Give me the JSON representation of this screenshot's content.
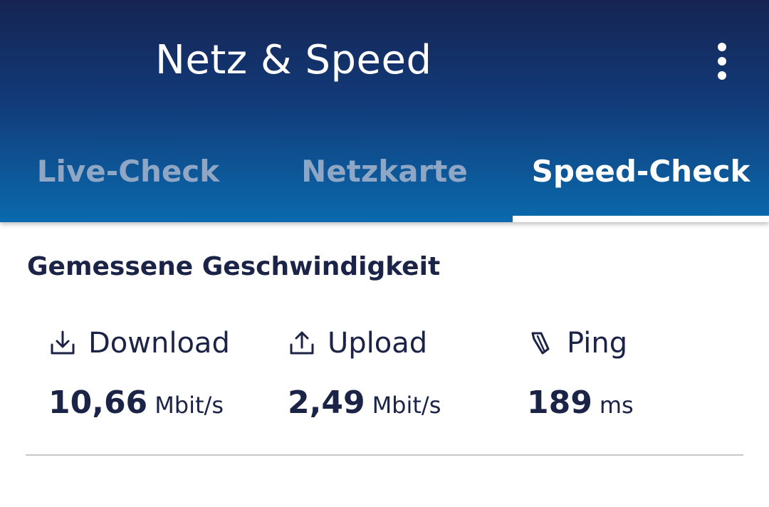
{
  "appbar": {
    "title": "Netz & Speed",
    "more_icon": "more-vertical-icon"
  },
  "tabs": [
    {
      "label": "Live-Check",
      "active": false
    },
    {
      "label": "Netzkarte",
      "active": false
    },
    {
      "label": "Speed-Check",
      "active": true
    }
  ],
  "section": {
    "title": "Gemessene Geschwindigkeit"
  },
  "metrics": {
    "download": {
      "label": "Download",
      "value": "10,66",
      "unit": "Mbit/s",
      "icon": "download-icon"
    },
    "upload": {
      "label": "Upload",
      "value": "2,49",
      "unit": "Mbit/s",
      "icon": "upload-icon"
    },
    "ping": {
      "label": "Ping",
      "value": "189",
      "unit": "ms",
      "icon": "ping-icon"
    }
  },
  "colors": {
    "appbar_top": "#152452",
    "appbar_bottom": "#0a6aad",
    "text_dark": "#1b2347",
    "tab_inactive": "#8fa7c4"
  }
}
